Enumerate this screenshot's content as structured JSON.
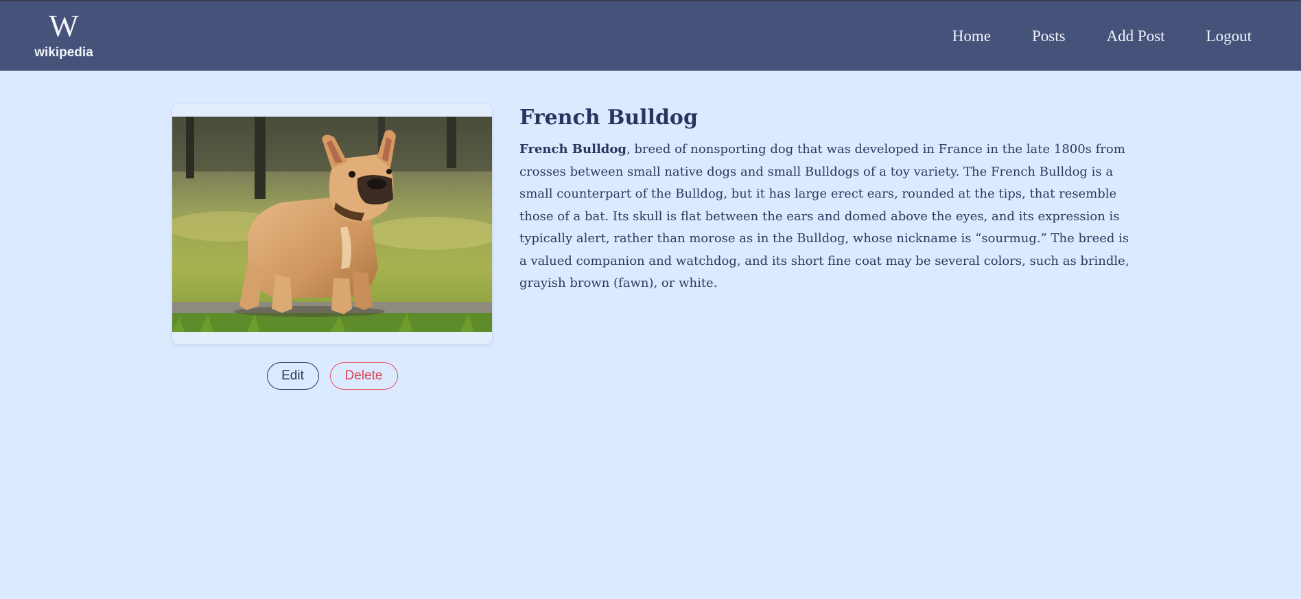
{
  "nav": {
    "logo_glyph": "W",
    "logo_text": "wikipedia",
    "links": [
      "Home",
      "Posts",
      "Add Post",
      "Logout"
    ]
  },
  "post": {
    "title": "French Bulldog",
    "lead_bold": "French Bulldog",
    "body": ", breed of nonsporting dog that was developed in France in the late 1800s from crosses between small native dogs and small Bulldogs of a toy variety. The French Bulldog is a small counterpart of the Bulldog, but it has large erect ears, rounded at the tips, that resemble those of a bat. Its skull is flat between the ears and domed above the eyes, and its expression is typically alert, rather than morose as in the Bulldog, whose nickname is “sourmug.” The breed is a valued companion and watchdog, and its short fine coat may be several colors, such as brindle, grayish brown (fawn), or white.",
    "edit_label": "Edit",
    "delete_label": "Delete"
  },
  "colors": {
    "navbar": "#45527a",
    "page_background": "#dbeafe",
    "title": "#27365f",
    "delete_accent": "#e0424f"
  },
  "icons": {
    "logo": "wikipedia-w-logo-icon",
    "photo": "french-bulldog-photo"
  }
}
